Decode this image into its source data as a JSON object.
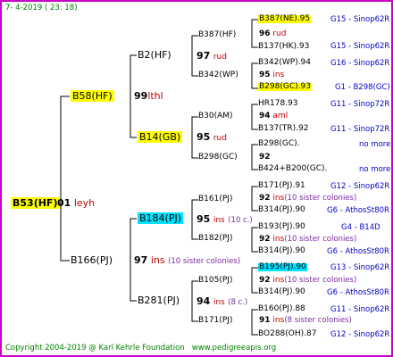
{
  "header": {
    "date": "7-  4-2019",
    "time": "( 23: 18)"
  },
  "gen0": {
    "name": "B53(HF)",
    "rating": "01",
    "note": "leyh"
  },
  "gen1": {
    "top": {
      "name": "B58(HF)",
      "rating": "99",
      "note": "lthl"
    },
    "bottom": {
      "name": "B166(PJ)",
      "rating": "97",
      "note": "ins",
      "note2": "(10 sister colonies)"
    }
  },
  "gen2": {
    "a": {
      "name": "B2(HF)",
      "rating": "97",
      "note": "rud"
    },
    "b": {
      "name": "B14(GB)",
      "rating": "95",
      "note": "rud"
    },
    "c": {
      "name": "B184(PJ)",
      "rating": "95",
      "note": "ins",
      "note2": "(10 c.)"
    },
    "d": {
      "name": "B281(PJ)",
      "rating": "94",
      "note": "ins",
      "note2": "(8 c.)"
    }
  },
  "gen3": {
    "a1": {
      "name": "B387(HF)"
    },
    "a2": {
      "name": "B342(WP)"
    },
    "b1": {
      "name": "B30(AM)",
      "rating": "94",
      "note": "aml"
    },
    "b2": {
      "name": "B298(GC)",
      "rating": "92"
    },
    "c1": {
      "name": "B161(PJ)",
      "rating": "92",
      "note": "ins",
      "note2": "(10 sister colonies)"
    },
    "c2": {
      "name": "B182(PJ)",
      "rating": "92",
      "note": "ins",
      "note2": "(10 sister colonies)"
    },
    "d1": {
      "name": "B105(PJ)",
      "rating": "92",
      "note": "ins",
      "note2": "(10 sister colonies)"
    },
    "d2": {
      "name": "B171(PJ)",
      "rating": "91",
      "note": "ins",
      "note2": "(8 sister colonies)"
    }
  },
  "gen3_children": {
    "a1_left": "B387(NE).95",
    "a1_rating": "96",
    "a1_note": "rud",
    "a1_right": "B137(HK).93",
    "a2_left": "B342(WP).94",
    "a2_rating": "95",
    "a2_note": "ins",
    "a2_right": "B298(GC).93",
    "b1_left": "HR178.93",
    "b1_right": "B137(TR).92",
    "b2_left": "B298(GC).",
    "b2_right": "B424+B200(GC).",
    "c1_left": "B171(PJ).91",
    "c1_right": "B314(PJ).90",
    "c2_left": "B193(PJ).90",
    "c2_right": "B314(PJ).90",
    "d1_left": "B195(PJ).90",
    "d1_right": "B314(PJ).90",
    "d2_left": "B160(PJ).88",
    "d2_right": "BO288(OH).87"
  },
  "right_labels": {
    "r1": "G15 - Sinop62R",
    "r2": "G15 - Sinop62R",
    "r3": "G16 - Sinop62R",
    "r4": "G1 - B298(GC)",
    "r5": "G11 - Sinop72R",
    "r6": "G11 - Sinop72R",
    "r7": "no more",
    "r8": "no more",
    "r9": "G12 - Sinop62R",
    "r10": "G6 - AthosSt80R",
    "r11": "G4 - B14D",
    "r12": "G6 - AthosSt80R",
    "r13": "G13 - Sinop62R",
    "r14": "G6 - AthosSt80R",
    "r15": "G11 - Sinop62R",
    "r16": "G12 - Sinop62R"
  },
  "footer": {
    "copyright": "Copyright 2004-2019 @ Karl Kehrle Foundation",
    "url": "www.pedigreeapis.org"
  }
}
